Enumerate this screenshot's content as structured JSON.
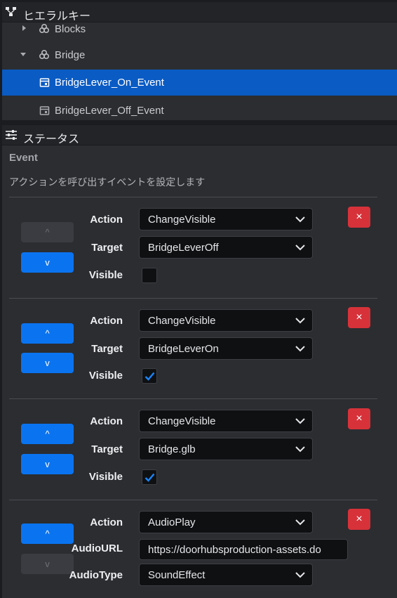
{
  "hierarchy": {
    "title": "ヒエラルキー",
    "items": [
      {
        "label": "Blocks"
      },
      {
        "label": "Bridge"
      },
      {
        "label": "BridgeLever_On_Event"
      },
      {
        "label": "BridgeLever_Off_Event"
      }
    ]
  },
  "status": {
    "title": "ステータス",
    "section": "Event",
    "description": "アクションを呼び出すイベントを設定します",
    "up_symbol": "^",
    "down_symbol": "v",
    "delete_symbol": "×",
    "actions": [
      {
        "action_label": "Action",
        "action_value": "ChangeVisible",
        "target_label": "Target",
        "target_value": "BridgeLeverOff",
        "visible_label": "Visible",
        "visible_checked": false,
        "up_enabled": false,
        "down_enabled": true
      },
      {
        "action_label": "Action",
        "action_value": "ChangeVisible",
        "target_label": "Target",
        "target_value": "BridgeLeverOn",
        "visible_label": "Visible",
        "visible_checked": true,
        "up_enabled": true,
        "down_enabled": true
      },
      {
        "action_label": "Action",
        "action_value": "ChangeVisible",
        "target_label": "Target",
        "target_value": "Bridge.glb",
        "visible_label": "Visible",
        "visible_checked": true,
        "up_enabled": true,
        "down_enabled": true
      },
      {
        "action_label": "Action",
        "action_value": "AudioPlay",
        "audiourl_label": "AudioURL",
        "audiourl_value": "https://doorhubsproduction-assets.do",
        "audiotype_label": "AudioType",
        "audiotype_value": "SoundEffect",
        "up_enabled": true,
        "down_enabled": false
      }
    ]
  },
  "colors": {
    "accent": "#0a74f0",
    "selection": "#0a5bc4",
    "delete": "#d7323a",
    "panel": "#2b2d31"
  }
}
